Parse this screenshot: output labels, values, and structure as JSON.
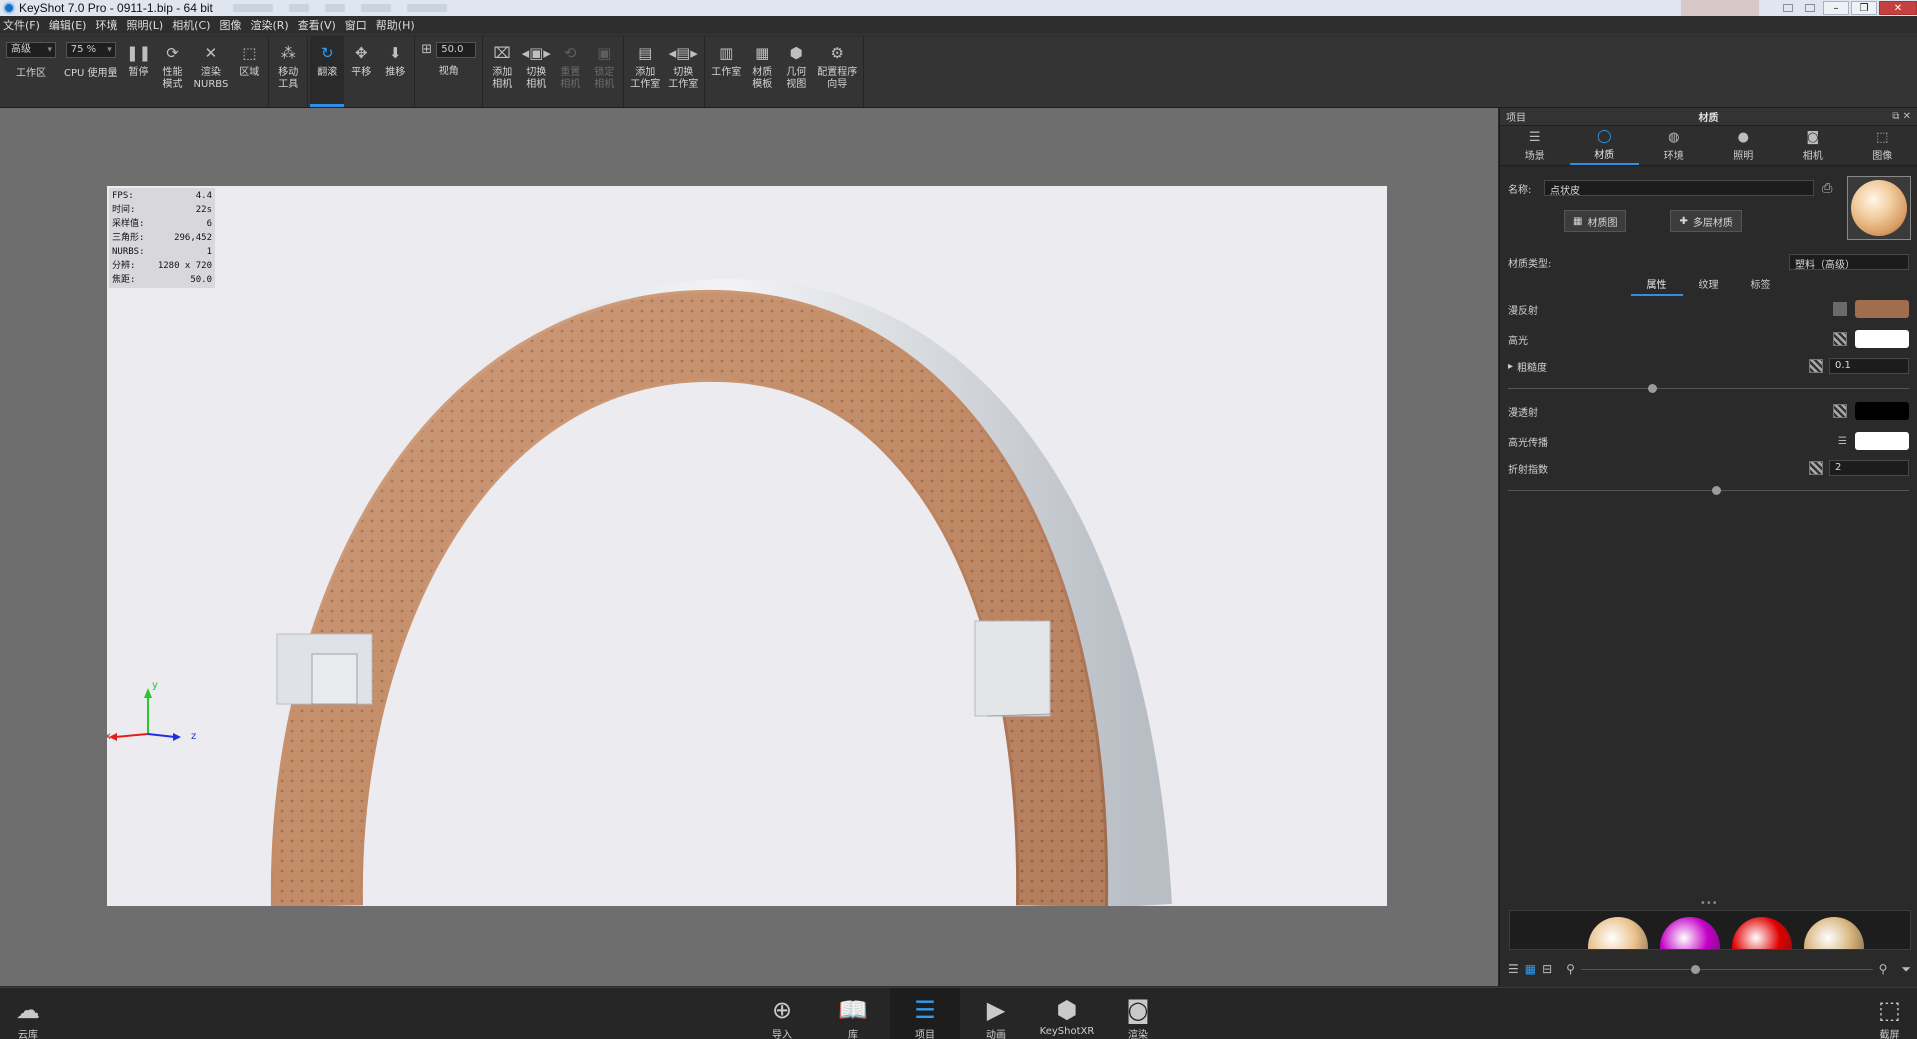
{
  "window": {
    "title": "KeyShot 7.0 Pro  - 0911-1.bip  - 64 bit",
    "controls": [
      "–",
      "❐",
      "✕"
    ]
  },
  "menu": [
    "文件(F)",
    "编辑(E)",
    "环境",
    "照明(L)",
    "相机(C)",
    "图像",
    "渲染(R)",
    "查看(V)",
    "窗口",
    "帮助(H)"
  ],
  "toolbar": {
    "quality_select": "高级",
    "cpu_select": "75 %",
    "workspace": "工作区",
    "cpu_usage": "CPU 使用量",
    "pause": "暂停",
    "performance": "性能\n模式",
    "render_nurbs": "渲染\nNURBS",
    "region": "区域",
    "move_tool": "移动\n工具",
    "tumble": "翻滚",
    "pan": "平移",
    "dolly": "推移",
    "fov_value": "50.0",
    "fov": "视角",
    "add_camera": "添加\n相机",
    "switch_camera": "切换\n相机",
    "reset_camera": "重置\n相机",
    "lock_camera": "锁定\n相机",
    "add_studio": "添加\n工作室",
    "switch_studio": "切换\n工作室",
    "studio": "工作室",
    "material_template": "材质\n模板",
    "geometry_view": "几何\n视图",
    "config_wizard": "配置程序\n向导"
  },
  "stats": [
    {
      "label": "FPS:",
      "value": "4.4"
    },
    {
      "label": "时间:",
      "value": "22s"
    },
    {
      "label": "采样值:",
      "value": "6"
    },
    {
      "label": "三角形:",
      "value": "296,452"
    },
    {
      "label": "NURBS:",
      "value": "1"
    },
    {
      "label": "分辨:",
      "value": "1280 x 720"
    },
    {
      "label": "焦距:",
      "value": "50.0"
    }
  ],
  "axes": {
    "x": "x",
    "y": "y",
    "z": "z"
  },
  "panel": {
    "left_title": "项目",
    "title": "材质",
    "tabs": [
      {
        "label": "场景",
        "icon": "scene-icon"
      },
      {
        "label": "材质",
        "icon": "material-icon"
      },
      {
        "label": "环境",
        "icon": "environment-icon"
      },
      {
        "label": "照明",
        "icon": "lighting-icon"
      },
      {
        "label": "相机",
        "icon": "camera-icon"
      },
      {
        "label": "图像",
        "icon": "image-icon"
      }
    ],
    "name_label": "名称:",
    "name_value": "点状皮",
    "material_graph": "材质图",
    "multi_material": "多层材质",
    "material_type_label": "材质类型:",
    "material_type_value": "塑料（高级）",
    "subtabs": [
      "属性",
      "纹理",
      "标签"
    ],
    "props": {
      "diffuse": "漫反射",
      "specular": "高光",
      "roughness": "粗糙度",
      "roughness_value": "0.1",
      "diffuse_transmission": "漫透射",
      "specular_transmission": "高光传播",
      "ior": "折射指数",
      "ior_value": "2"
    },
    "colors": {
      "diffuse": "#a06e4e",
      "specular": "#ffffff",
      "diffuse_transmission": "#000000",
      "specular_transmission": "#ffffff"
    },
    "library_colors": [
      "#e9c08a",
      "#c300c8",
      "#e00000",
      "#d6b27a"
    ]
  },
  "dock": [
    "导入",
    "库",
    "项目",
    "动画",
    "KeyShotXR",
    "渲染"
  ],
  "dock_left": "云库",
  "dock_right": "截屏"
}
